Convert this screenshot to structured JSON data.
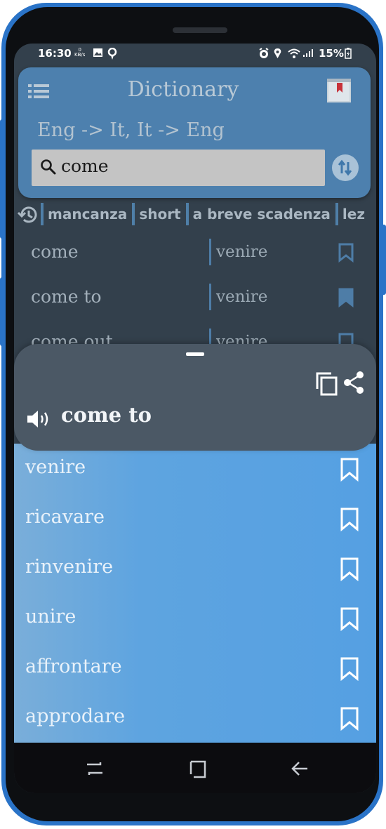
{
  "status_bar": {
    "time": "16:30",
    "kbs_value": "0",
    "kbs_unit": "KB/s",
    "battery": "15%",
    "icons": [
      "gallery-icon",
      "location-icon",
      "alarm-icon",
      "location-icon",
      "wifi-icon",
      "signal-icon",
      "battery-charging-icon"
    ]
  },
  "header": {
    "title": "Dictionary",
    "menu_icon": "hamburger-menu-icon",
    "bookmarks_icon": "bookmark-book-icon",
    "direction": "Eng -> It,  It -> Eng"
  },
  "search": {
    "icon": "search-icon",
    "value": "come",
    "swap_icon": "swap-direction-icon"
  },
  "history": {
    "icon": "history-icon",
    "chips": [
      "mancanza",
      "short",
      "a breve scadenza",
      "lez"
    ]
  },
  "results": [
    {
      "term": "come",
      "translation": "venire",
      "bookmarked": false
    },
    {
      "term": "come to",
      "translation": "venire",
      "bookmarked": true
    },
    {
      "term": "come out",
      "translation": "venire",
      "bookmarked": false
    }
  ],
  "detail": {
    "word": "come to",
    "speaker_icon": "speaker-icon",
    "copy_icon": "copy-icon",
    "share_icon": "share-icon",
    "translations": [
      "venire",
      "ricavare",
      "rinvenire",
      "unire",
      "affrontare",
      "approdare"
    ]
  },
  "nav": {
    "buttons": [
      "recents-icon",
      "home-icon",
      "back-icon"
    ]
  },
  "colors": {
    "frame_blue": "#2a73c7",
    "header_card": "#4d80ae",
    "sheet_header": "#4b5865",
    "sheet_list": "#5ea4e0",
    "screen_bg": "#33404c"
  }
}
